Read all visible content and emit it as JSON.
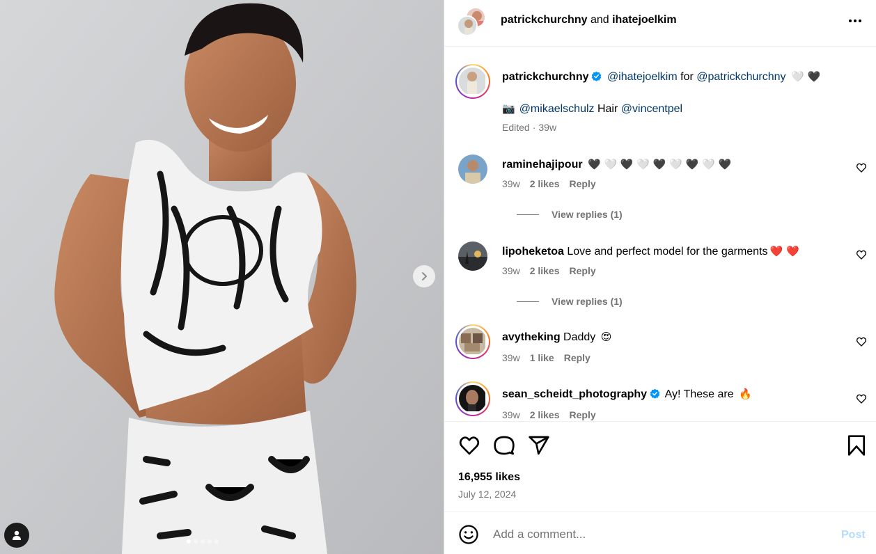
{
  "post": {
    "header_user_1": "patrickchurchny",
    "header_and": "and",
    "header_user_2": "ihatejoelkim",
    "more_icon": "more-horizontal-icon"
  },
  "caption": {
    "username": "patrickchurchny",
    "mention_1": "@ihatejoelkim",
    "for_text": "for",
    "mention_2": "@patrickchurchny",
    "hearts": "🤍 🖤",
    "camera": "📷",
    "mention_3": "@mikaelschulz",
    "hair_text": "Hair",
    "mention_4": "@vincentpel",
    "edited": "Edited",
    "age": "39w"
  },
  "comments": [
    {
      "username": "raminehajipour",
      "text": "🖤 🤍 🖤 🤍 🖤 🤍 🖤 🤍 🖤",
      "age": "39w",
      "likes": "2 likes",
      "reply": "Reply",
      "view_replies": "View replies (1)"
    },
    {
      "username": "lipoheketoa",
      "text": "Love and perfect model for the garments",
      "emoji": "❤️ ❤️",
      "age": "39w",
      "likes": "2 likes",
      "reply": "Reply",
      "view_replies": "View replies (1)"
    },
    {
      "username": "avytheking",
      "text": "Daddy",
      "emoji": "😍",
      "age": "39w",
      "likes": "1 like",
      "reply": "Reply"
    },
    {
      "username": "sean_scheidt_photography",
      "text": "Ay! These are",
      "emoji": "🔥",
      "age": "39w",
      "likes": "2 likes",
      "reply": "Reply"
    }
  ],
  "actions": {
    "likes_count": "16,955 likes",
    "date": "July 12, 2024"
  },
  "comment_bar": {
    "placeholder": "Add a comment...",
    "post_label": "Post"
  },
  "colors": {
    "mention": "#00376b",
    "verified": "#0095f6",
    "secondary_text": "#737373",
    "post_disabled": "#b3dbff"
  }
}
